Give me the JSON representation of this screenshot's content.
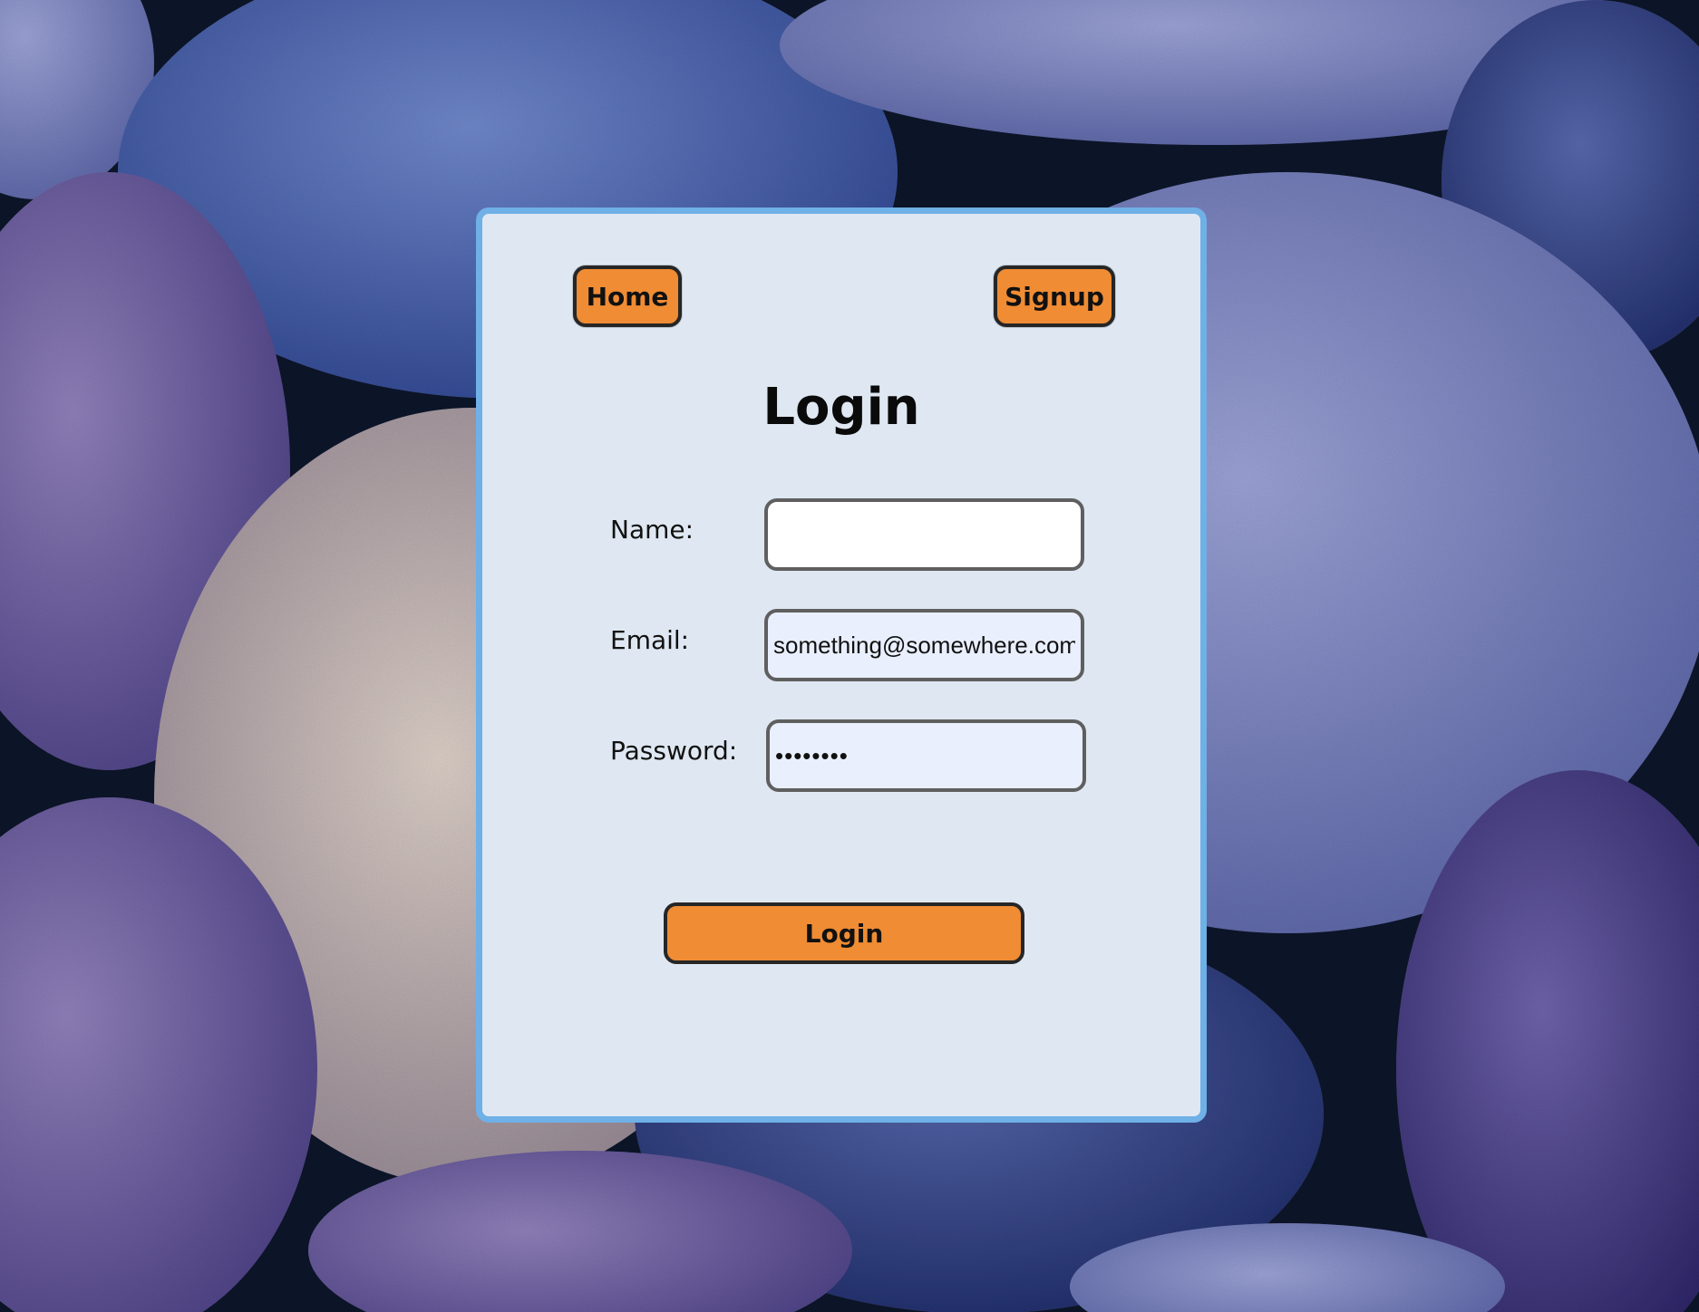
{
  "background": {
    "description_icon": "pebbles-background",
    "colors": [
      "#3f5aa6",
      "#6a5f9e",
      "#c0b2a8",
      "#7a86c2",
      "#26357a",
      "#0c1428"
    ]
  },
  "nav": {
    "home_label": "Home",
    "signup_label": "Signup"
  },
  "form": {
    "title": "Login",
    "fields": [
      {
        "label": "Name:",
        "value": ""
      },
      {
        "label": "Email:",
        "value": "something@somewhere.com"
      },
      {
        "label": "Password:",
        "value": "password"
      }
    ],
    "submit_label": "Login"
  },
  "colors": {
    "accent": "#f08c34",
    "card_background": "#dfe8f2",
    "card_border": "#6fb0e6",
    "autofill_background": "#e9effc"
  }
}
